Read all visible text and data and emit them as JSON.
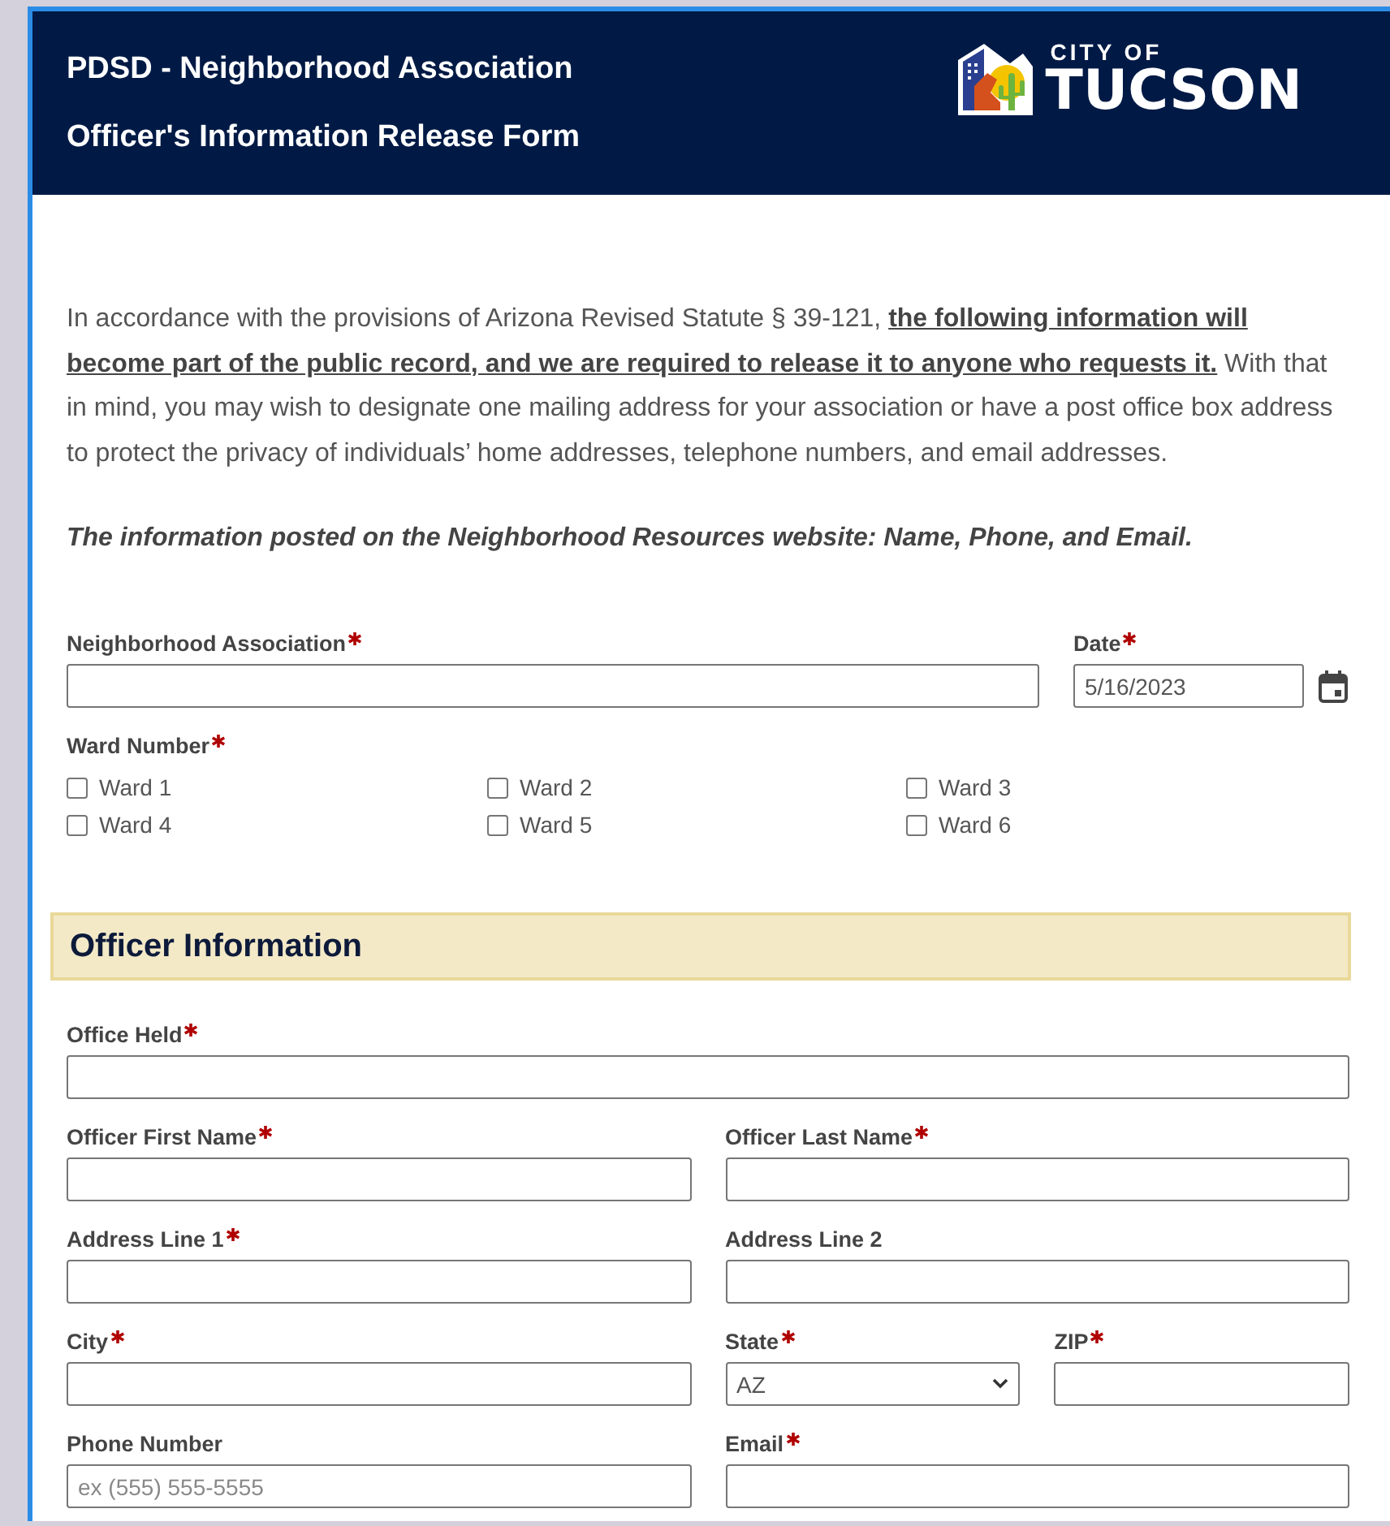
{
  "header": {
    "title_lines": [
      "PDSD - Neighborhood Association",
      "Officer's Information Release Form"
    ],
    "logo": {
      "line1": "CITY OF",
      "line2": "TUCSON"
    }
  },
  "intro": {
    "paragraph": "In accordance with the provisions of Arizona Revised Statute § 39-121, **the following information will become part of the public record, and we are required to release it to anyone who requests it.** With that in mind, you may wish to designate one mailing address for your association or have a post office box address to protect the privacy of individuals’ home addresses, telephone numbers, and email addresses.",
    "note": "The information posted on the Neighborhood Resources website: Name, Phone, and Email."
  },
  "association_rows": [
    [
      {
        "kind": "text",
        "label": "Neighborhood Association",
        "required": true
      },
      {
        "kind": "date",
        "label": "Date",
        "required": true,
        "value": "5/16/2023"
      }
    ]
  ],
  "wards": {
    "label": "Ward Number",
    "required": true,
    "options": [
      {
        "label": "Ward 1",
        "checked": false
      },
      {
        "label": "Ward 2",
        "checked": false
      },
      {
        "label": "Ward 3",
        "checked": false
      },
      {
        "label": "Ward 4",
        "checked": false
      },
      {
        "label": "Ward 5",
        "checked": false
      },
      {
        "label": "Ward 6",
        "checked": false
      }
    ]
  },
  "officer_section": {
    "title": "Officer Information",
    "rows": [
      [
        {
          "kind": "text",
          "label": "Office Held",
          "required": true
        }
      ],
      [
        {
          "kind": "text",
          "label": "Officer First Name",
          "required": true
        },
        {
          "kind": "text",
          "label": "Officer Last Name",
          "required": true
        }
      ],
      [
        {
          "kind": "text",
          "label": "Address Line 1",
          "required": true
        },
        {
          "kind": "text",
          "label": "Address Line 2",
          "required": false
        }
      ],
      [
        {
          "kind": "text",
          "label": "City",
          "required": true
        },
        {
          "kind": "select",
          "label": "State",
          "required": true,
          "value": "AZ"
        },
        {
          "kind": "text",
          "label": "ZIP",
          "required": true
        }
      ],
      [
        {
          "kind": "text",
          "label": "Phone Number",
          "required": false,
          "placeholder": "ex (555) 555-5555"
        },
        {
          "kind": "text",
          "label": "Email",
          "required": true
        }
      ]
    ]
  }
}
